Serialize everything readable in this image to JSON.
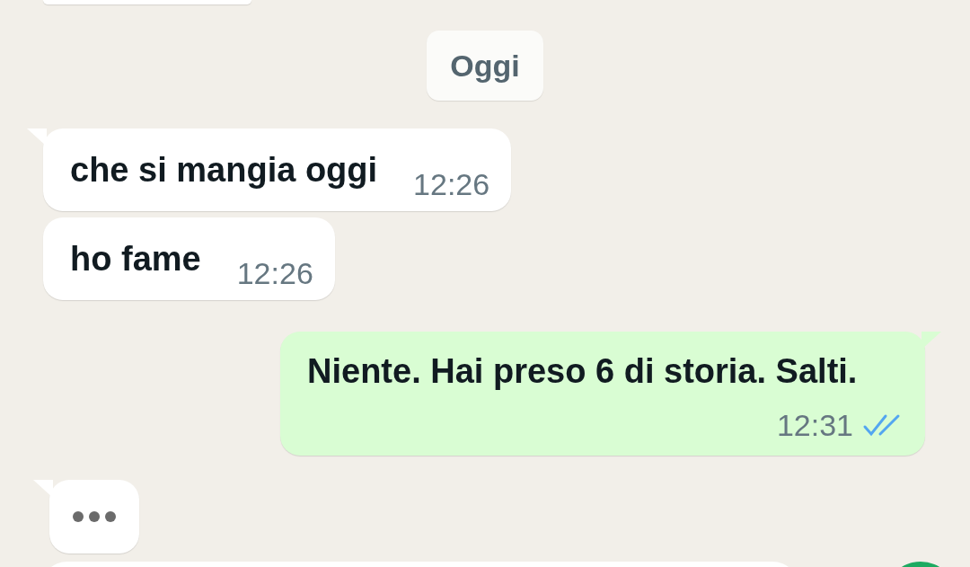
{
  "date_chip": "Oggi",
  "messages": [
    {
      "kind": "incoming",
      "text": "che si mangia oggi",
      "time": "12:26",
      "tail": true
    },
    {
      "kind": "incoming",
      "text": "ho fame",
      "time": "12:26",
      "tail": false
    },
    {
      "kind": "outgoing",
      "text": "Niente. Hai preso 6 di storia. Salti.",
      "time": "12:31",
      "read": true,
      "tail": true
    },
    {
      "kind": "typing",
      "tail": true
    }
  ]
}
